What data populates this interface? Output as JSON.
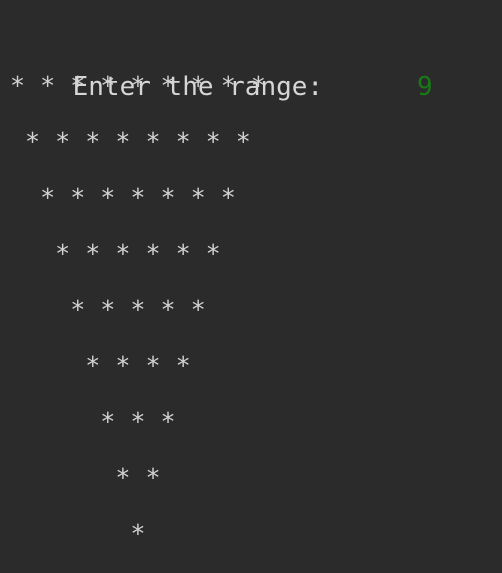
{
  "terminal": {
    "background_color": "#2b2b2b",
    "text_color": "#d2d2d2",
    "input_color": "#177a17",
    "prompt": {
      "label": "Enter the range:",
      "spacer": "      ",
      "value": "9"
    },
    "output_rows": [
      "* * * * * * * * *",
      " * * * * * * * *",
      "  * * * * * * *",
      "   * * * * * *",
      "    * * * * *",
      "     * * * *",
      "      * * *",
      "       * *",
      "        *"
    ]
  }
}
